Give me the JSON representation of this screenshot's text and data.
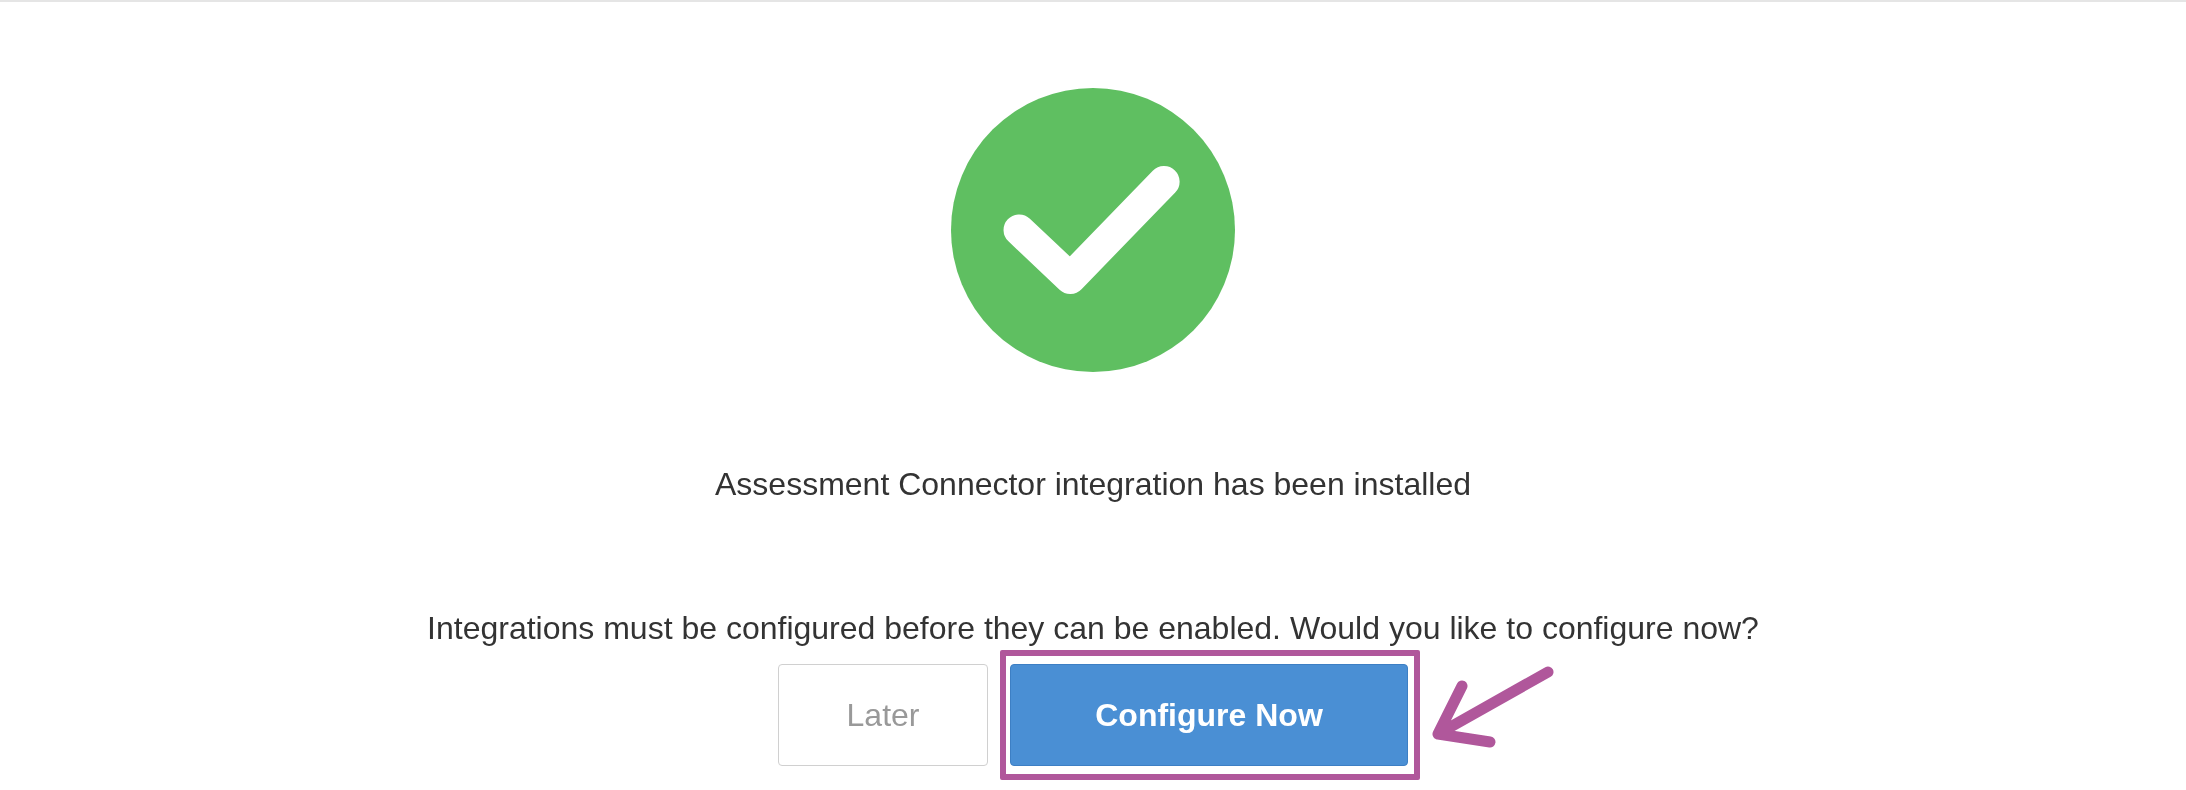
{
  "dialog": {
    "message": "Assessment Connector integration has been installed",
    "prompt": "Integrations must be configured before they can be enabled. Would you like to configure now?",
    "buttons": [
      {
        "label": "Later",
        "kind": "secondary"
      },
      {
        "label": "Configure Now",
        "kind": "primary",
        "highlighted": true
      }
    ]
  }
}
